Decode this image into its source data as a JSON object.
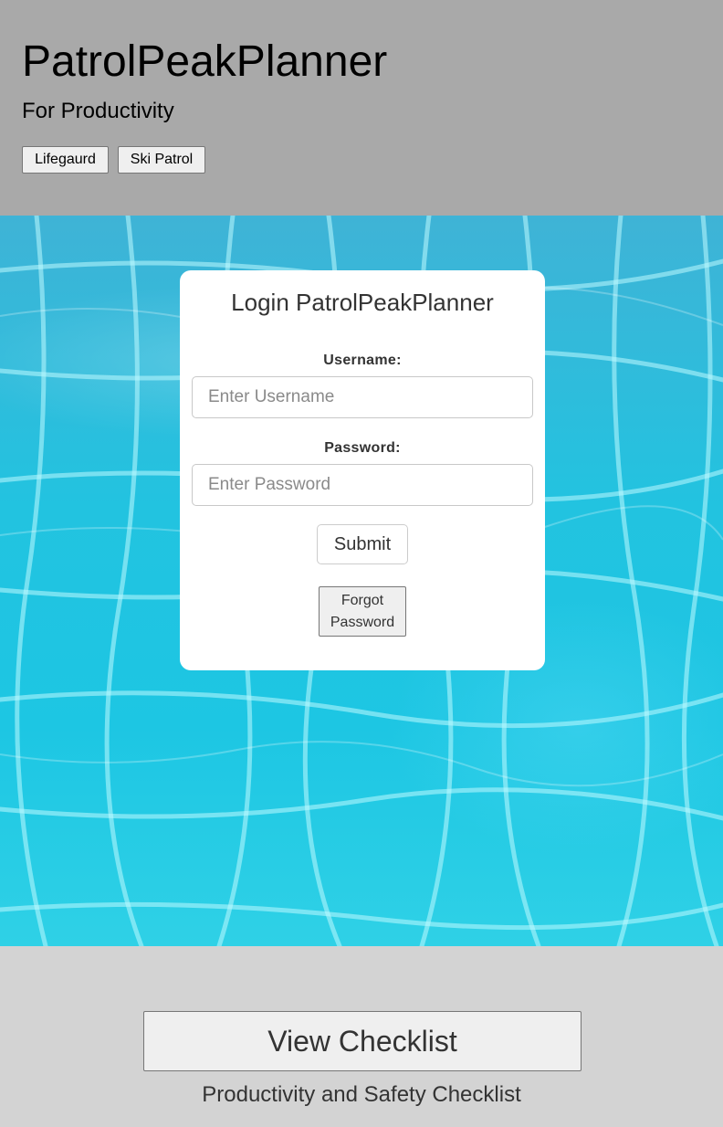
{
  "header": {
    "title": "PatrolPeakPlanner",
    "subtitle": "For Productivity",
    "nav": {
      "lifeguard_label": "Lifegaurd",
      "ski_patrol_label": "Ski Patrol"
    }
  },
  "login": {
    "title": "Login PatrolPeakPlanner",
    "username_label": "Username:",
    "username_placeholder": "Enter Username",
    "username_value": "",
    "password_label": "Password:",
    "password_placeholder": "Enter Password",
    "password_value": "",
    "submit_label": "Submit",
    "forgot_label": "Forgot Password"
  },
  "footer": {
    "checklist_button_label": "View Checklist",
    "checklist_caption": "Productivity and Safety Checklist"
  },
  "colors": {
    "header_bg": "#a9a9a9",
    "footer_bg": "#d3d3d3",
    "card_bg": "#ffffff",
    "water": "#1dc6e3"
  }
}
